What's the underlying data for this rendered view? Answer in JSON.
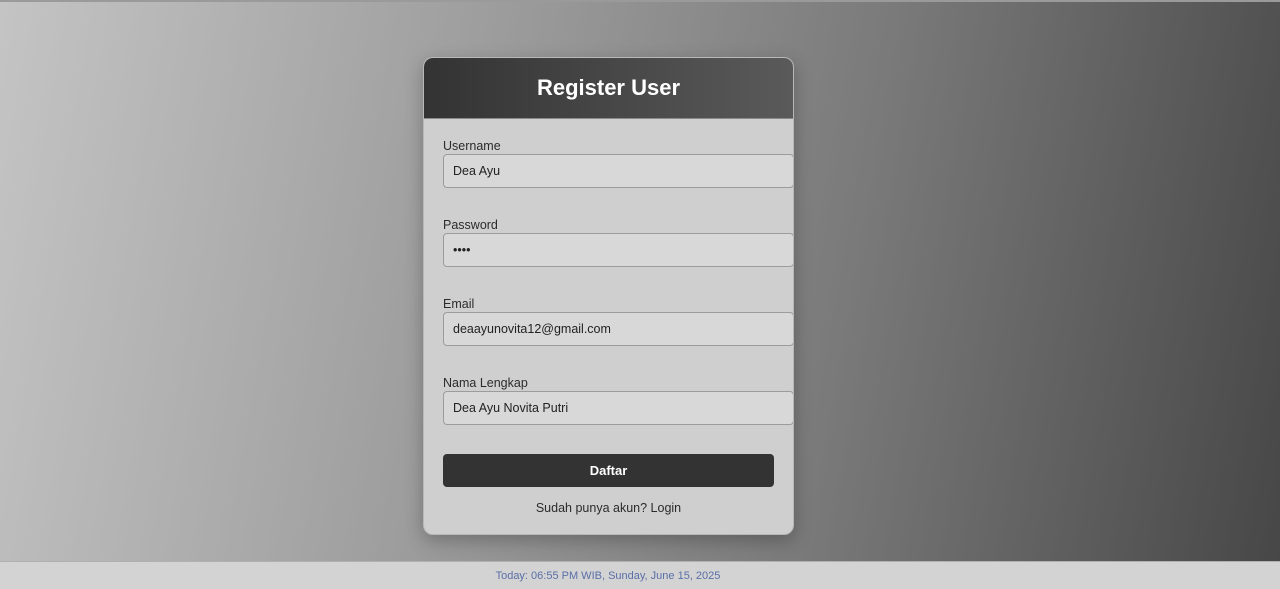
{
  "form": {
    "title": "Register User",
    "fields": {
      "username": {
        "label": "Username",
        "value": "Dea Ayu"
      },
      "password": {
        "label": "Password",
        "value": "••••"
      },
      "email": {
        "label": "Email",
        "value": "deaayunovita12@gmail.com"
      },
      "fullname": {
        "label": "Nama Lengkap",
        "value": "Dea Ayu Novita Putri"
      }
    },
    "submit_label": "Daftar",
    "login_prompt": "Sudah punya akun?",
    "login_link": "Login"
  },
  "footer": {
    "text": "Today: 06:55 PM WIB, Sunday, June 15, 2025"
  },
  "colors": {
    "header_dark": "#333333",
    "button": "#333333",
    "card_bg": "#cfcfcf",
    "footer_text": "#5a6fa8"
  }
}
